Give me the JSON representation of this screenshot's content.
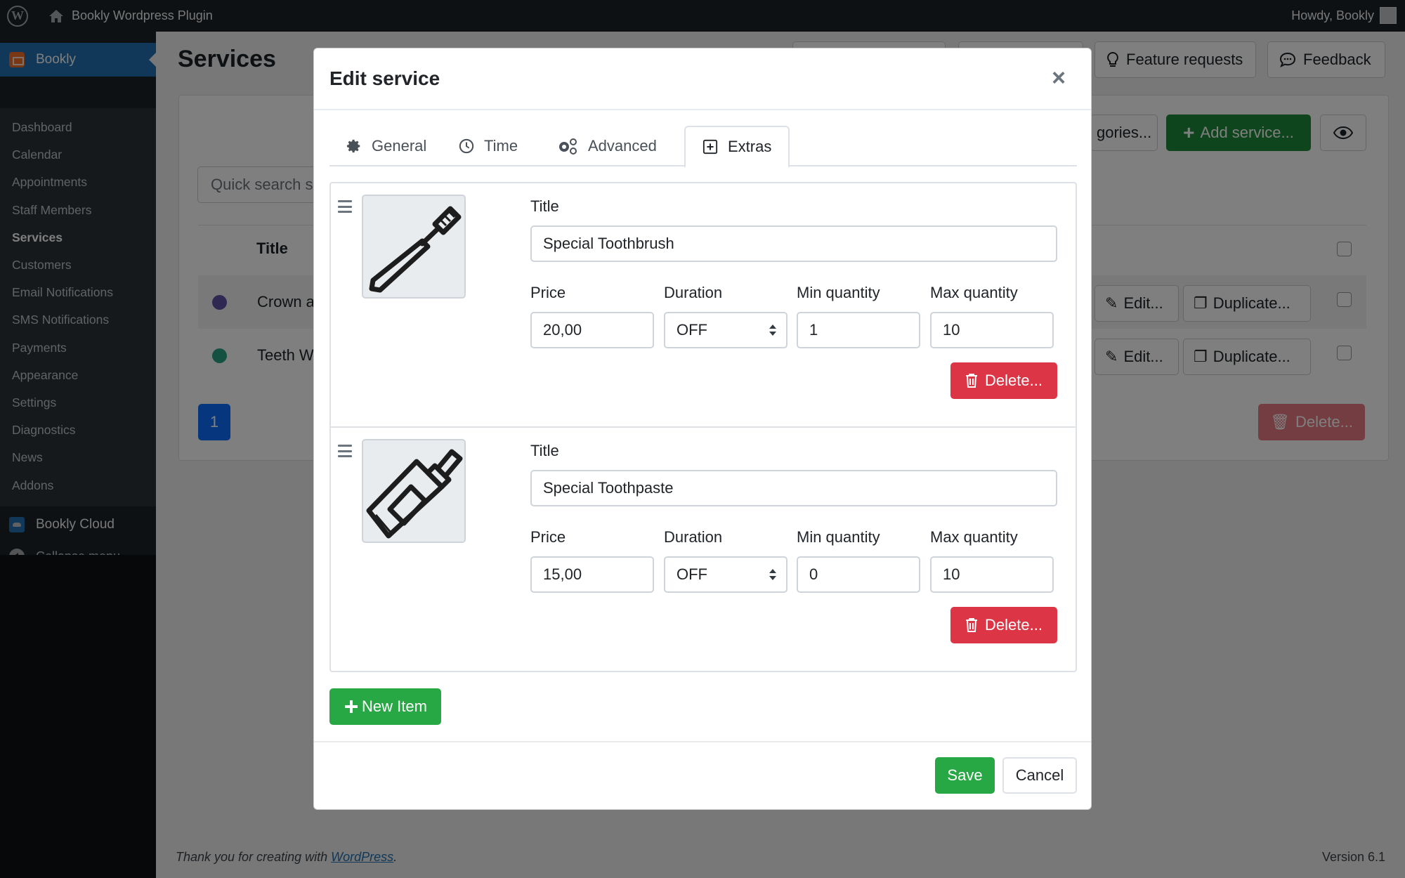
{
  "adminbar": {
    "site_name": "Bookly Wordpress Plugin",
    "howdy": "Howdy, Bookly"
  },
  "sidebar": {
    "plugin_label": "Bookly",
    "items": [
      {
        "label": "Dashboard"
      },
      {
        "label": "Calendar"
      },
      {
        "label": "Appointments"
      },
      {
        "label": "Staff Members"
      },
      {
        "label": "Services",
        "current": true
      },
      {
        "label": "Customers"
      },
      {
        "label": "Email Notifications"
      },
      {
        "label": "SMS Notifications"
      },
      {
        "label": "Payments"
      },
      {
        "label": "Appearance"
      },
      {
        "label": "Settings"
      },
      {
        "label": "Diagnostics"
      },
      {
        "label": "News"
      },
      {
        "label": "Addons"
      }
    ],
    "cloud_label": "Bookly Cloud",
    "collapse_label": "Collapse menu"
  },
  "page": {
    "title": "Services",
    "feature_requests": "Feature requests",
    "feedback": "Feedback",
    "categories_btn": "gories...",
    "add_service": "Add service...",
    "search_placeholder": "Quick search s",
    "table_header_title": "Title",
    "rows": [
      {
        "title": "Crown a",
        "color": "#5e50a6"
      },
      {
        "title": "Teeth W",
        "color": "#29a383"
      }
    ],
    "edit_label": "Edit...",
    "duplicate_label": "Duplicate...",
    "delete_label": "Delete...",
    "pagination_current": "1"
  },
  "footer": {
    "thanks_prefix": "Thank you for creating with ",
    "wordpress_link": "WordPress",
    "thanks_suffix": ".",
    "version": "Version 6.1"
  },
  "modal": {
    "title": "Edit service",
    "close": "×",
    "tabs": [
      {
        "label": "General",
        "icon": "gear-icon"
      },
      {
        "label": "Time",
        "icon": "clock-icon"
      },
      {
        "label": "Advanced",
        "icon": "gears-icon"
      },
      {
        "label": "Extras",
        "icon": "plus-square-icon",
        "active": true
      }
    ],
    "labels": {
      "title": "Title",
      "price": "Price",
      "duration": "Duration",
      "min_quantity": "Min quantity",
      "max_quantity": "Max quantity"
    },
    "extras": [
      {
        "image": "toothbrush-icon",
        "title": "Special Toothbrush",
        "price": "20,00",
        "duration": "OFF",
        "min_quantity": "1",
        "max_quantity": "10"
      },
      {
        "image": "toothpaste-icon",
        "title": "Special Toothpaste",
        "price": "15,00",
        "duration": "OFF",
        "min_quantity": "0",
        "max_quantity": "10"
      }
    ],
    "delete_label": "Delete...",
    "new_item": "New Item",
    "save": "Save",
    "cancel": "Cancel"
  }
}
